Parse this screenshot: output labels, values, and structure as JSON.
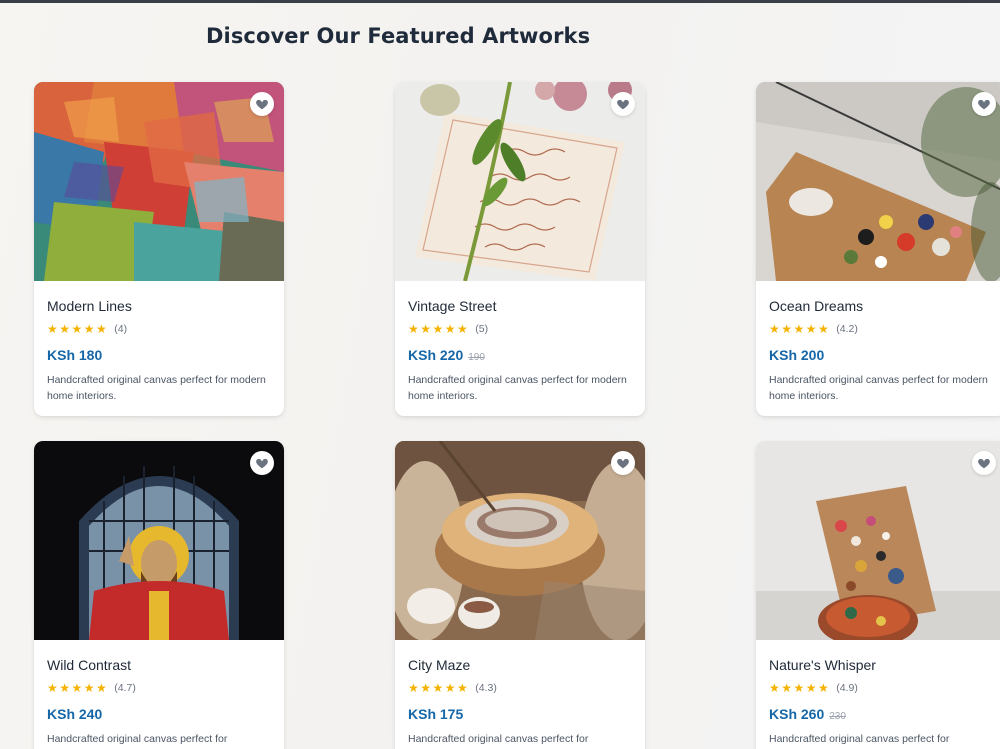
{
  "page": {
    "heading": "Discover Our Featured Artworks"
  },
  "colors": {
    "accent_price": "#1567a8",
    "star": "#f5b301",
    "favorite_icon": "#6b7280"
  },
  "artworks": [
    {
      "title": "Modern Lines",
      "stars": "★★★★★",
      "rating": "(4)",
      "price": "KSh 180",
      "old_price": "",
      "description": "Handcrafted original canvas perfect for modern home interiors.",
      "icon": "heart-icon"
    },
    {
      "title": "Vintage Street",
      "stars": "★★★★★",
      "rating": "(5)",
      "price": "KSh 220",
      "old_price": "190",
      "description": "Handcrafted original canvas perfect for modern home interiors.",
      "icon": "heart-icon"
    },
    {
      "title": "Ocean Dreams",
      "stars": "★★★★★",
      "rating": "(4.2)",
      "price": "KSh 200",
      "old_price": "",
      "description": "Handcrafted original canvas perfect for modern home interiors.",
      "icon": "heart-icon"
    },
    {
      "title": "Wild Contrast",
      "stars": "★★★★★",
      "rating": "(4.7)",
      "price": "KSh 240",
      "old_price": "",
      "description": "Handcrafted original canvas perfect for",
      "icon": "heart-icon"
    },
    {
      "title": "City Maze",
      "stars": "★★★★★",
      "rating": "(4.3)",
      "price": "KSh 175",
      "old_price": "",
      "description": "Handcrafted original canvas perfect for",
      "icon": "heart-icon"
    },
    {
      "title": "Nature's Whisper",
      "stars": "★★★★★",
      "rating": "(4.9)",
      "price": "KSh 260",
      "old_price": "230",
      "description": "Handcrafted original canvas perfect for",
      "icon": "heart-icon"
    }
  ]
}
